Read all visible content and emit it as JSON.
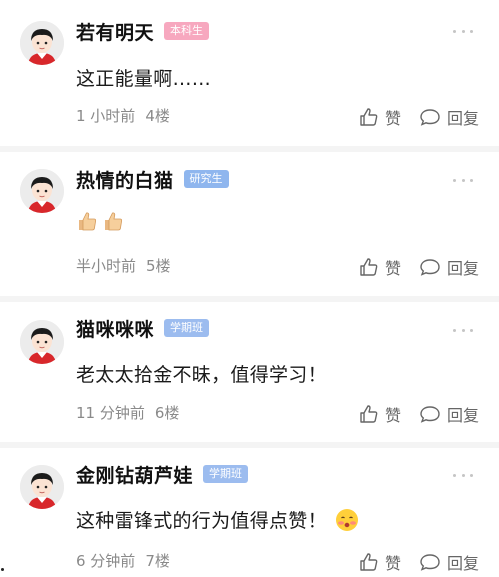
{
  "colors": {
    "badge_undergrad": "#f7a8bf",
    "badge_grad": "#8fb6ee",
    "badge_study": "#9cbcef"
  },
  "icons": {
    "like": "thumbs-up-outline",
    "reply": "speech-bubble-outline",
    "more": "three-dots"
  },
  "comments": [
    {
      "name": "若有明天",
      "badge": "本科生",
      "content": "这正能量啊……",
      "time": "1 小时前",
      "floor": "4楼",
      "like_label": "赞",
      "reply_label": "回复"
    },
    {
      "name": "热情的白猫",
      "badge": "研究生",
      "content": "",
      "content_emoji": [
        "thumbs-up-emoji",
        "thumbs-up-emoji"
      ],
      "time": "半小时前",
      "floor": "5楼",
      "like_label": "赞",
      "reply_label": "回复"
    },
    {
      "name": "猫咪咪咪",
      "badge": "学期班",
      "content": "老太太拾金不昧，值得学习！",
      "time": "11 分钟前",
      "floor": "6楼",
      "like_label": "赞",
      "reply_label": "回复"
    },
    {
      "name": "金刚钻葫芦娃",
      "badge": "学期班",
      "content": "这种雷锋式的行为值得点赞！",
      "content_emoji": [
        "blushing-face-emoji"
      ],
      "time": "6 分钟前",
      "floor": "7楼",
      "like_label": "赞",
      "reply_label": "回复"
    }
  ]
}
